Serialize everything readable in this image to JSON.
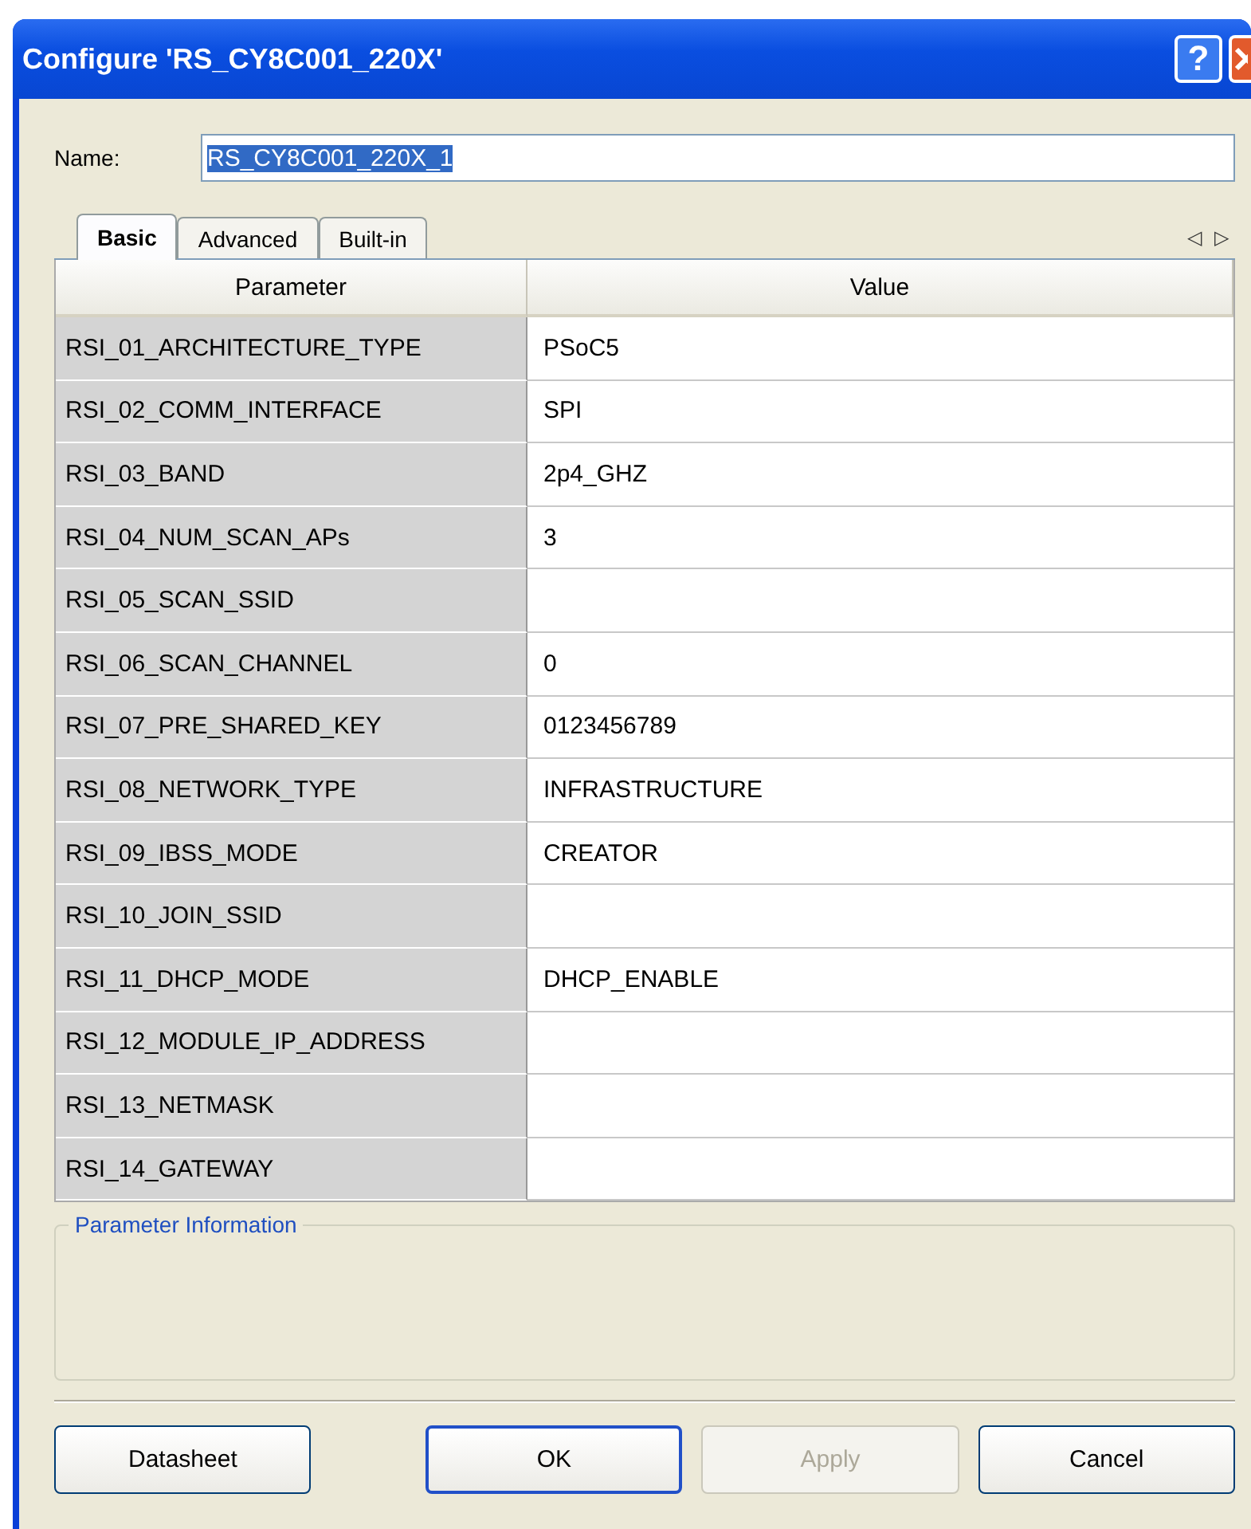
{
  "window": {
    "title": "Configure 'RS_CY8C001_220X'",
    "help_glyph": "?"
  },
  "name_field": {
    "label": "Name:",
    "value": "RS_CY8C001_220X_1",
    "text_selected": true
  },
  "tabs": [
    {
      "label": "Basic",
      "selected": true
    },
    {
      "label": "Advanced",
      "selected": false
    },
    {
      "label": "Built-in",
      "selected": false
    }
  ],
  "tab_scroll": {
    "left": "◁",
    "right": "▷"
  },
  "table": {
    "columns": [
      "Parameter",
      "Value"
    ],
    "rows": [
      {
        "parameter": "RSI_01_ARCHITECTURE_TYPE",
        "value": "PSoC5"
      },
      {
        "parameter": "RSI_02_COMM_INTERFACE",
        "value": "SPI"
      },
      {
        "parameter": "RSI_03_BAND",
        "value": "2p4_GHZ"
      },
      {
        "parameter": "RSI_04_NUM_SCAN_APs",
        "value": "3"
      },
      {
        "parameter": "RSI_05_SCAN_SSID"
      },
      {
        "parameter": "RSI_06_SCAN_CHANNEL",
        "value": "0"
      },
      {
        "parameter": "RSI_07_PRE_SHARED_KEY",
        "value": "0123456789"
      },
      {
        "parameter": "RSI_08_NETWORK_TYPE",
        "value": "INFRASTRUCTURE"
      },
      {
        "parameter": "RSI_09_IBSS_MODE",
        "value": "CREATOR"
      },
      {
        "parameter": "RSI_10_JOIN_SSID"
      },
      {
        "parameter": "RSI_11_DHCP_MODE",
        "value": "DHCP_ENABLE"
      },
      {
        "parameter": "RSI_12_MODULE_IP_ADDRESS"
      },
      {
        "parameter": "RSI_13_NETMASK"
      },
      {
        "parameter": "RSI_14_GATEWAY"
      }
    ]
  },
  "info_group": {
    "title": "Parameter Information"
  },
  "buttons": [
    {
      "label": "Datasheet",
      "disabled": false,
      "default": false
    },
    {
      "label": "OK",
      "disabled": false,
      "default": true
    },
    {
      "label": "Apply",
      "disabled": true,
      "default": false
    },
    {
      "label": "Cancel",
      "disabled": false,
      "default": false
    }
  ]
}
